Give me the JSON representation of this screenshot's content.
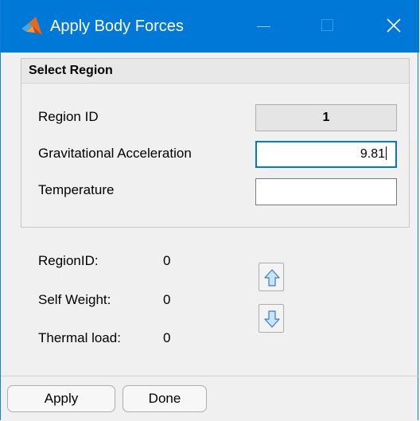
{
  "window": {
    "title": "Apply Body Forces",
    "accent_color": "#0078d7",
    "controls": [
      "minimize-icon",
      "maximize-icon",
      "close-icon"
    ]
  },
  "select_region": {
    "title": "Select Region",
    "region_id_label": "Region ID",
    "region_id_value": "1",
    "grav_accel_label": "Gravitational Acceleration",
    "grav_accel_value": "9.81",
    "temperature_label": "Temperature",
    "temperature_value": ""
  },
  "summary": {
    "items": [
      {
        "label": "RegionID:",
        "value": "0"
      },
      {
        "label": "Self Weight:",
        "value": "0"
      },
      {
        "label": "Thermal load:",
        "value": "0"
      }
    ],
    "up_icon": "arrow-up-icon",
    "down_icon": "arrow-down-icon"
  },
  "footer": {
    "apply_label": "Apply",
    "done_label": "Done"
  }
}
